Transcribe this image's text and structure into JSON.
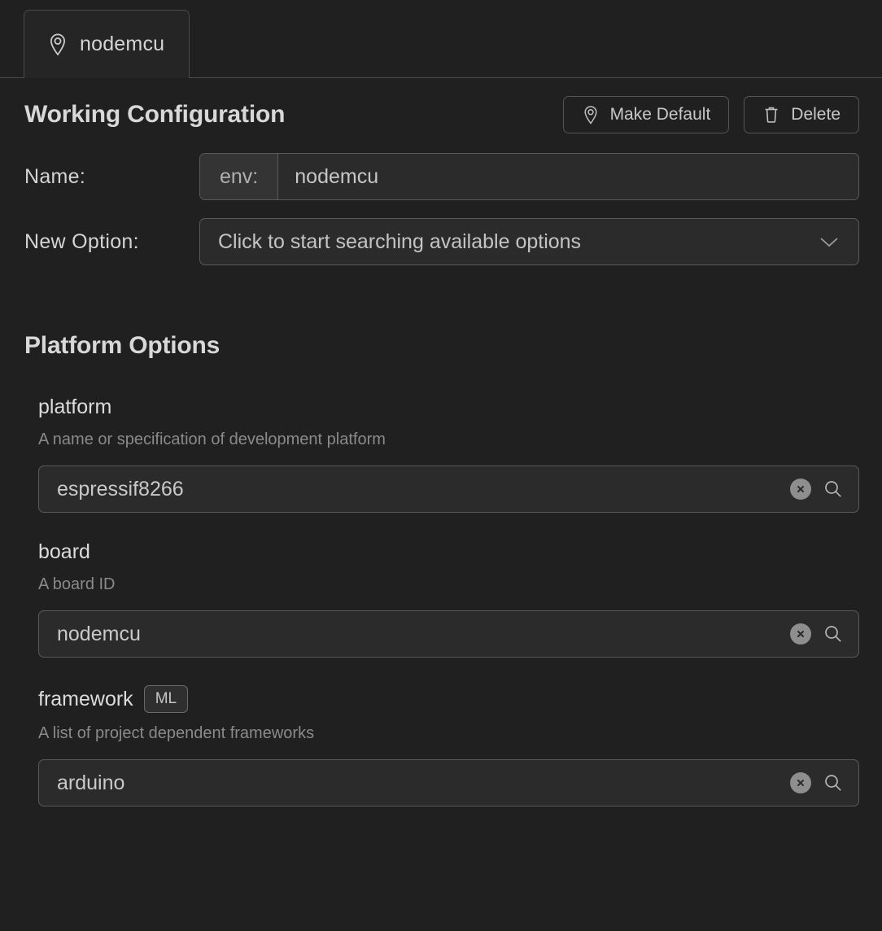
{
  "tabbar": {
    "tabs": [
      {
        "label": "nodemcu",
        "icon": "map-pin-icon",
        "active": true
      }
    ]
  },
  "header": {
    "title": "Working Configuration",
    "actions": [
      {
        "label": "Make Default",
        "icon": "map-pin-icon"
      },
      {
        "label": "Delete",
        "icon": "trash-icon"
      }
    ]
  },
  "form": {
    "name": {
      "label": "Name:",
      "prefix": "env:",
      "value": "nodemcu"
    },
    "new_option": {
      "label": "New Option:",
      "placeholder": "Click to start searching available options",
      "chevron": "chevron-down-icon"
    }
  },
  "platform_options": {
    "title": "Platform Options",
    "options": [
      {
        "name": "platform",
        "badge": null,
        "description": "A name or specification of development platform",
        "value": "espressif8266"
      },
      {
        "name": "board",
        "badge": null,
        "description": "A board ID",
        "value": "nodemcu"
      },
      {
        "name": "framework",
        "badge": "ML",
        "description": "A list of project dependent frameworks",
        "value": "arduino"
      }
    ]
  },
  "colors": {
    "background": "#202020",
    "surface": "#2b2b2b",
    "tab_active": "#252525",
    "border": "#5a5a5a",
    "text_primary": "#d4d4d4",
    "text_secondary": "#8a8a8a",
    "clear_button": "#8e8e8e"
  }
}
